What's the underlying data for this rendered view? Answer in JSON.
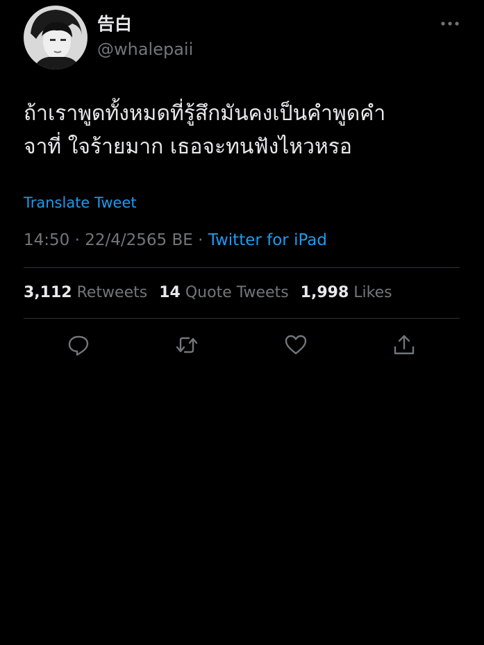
{
  "user": {
    "display_name": "告白",
    "handle": "@whalepaii",
    "avatar_icon": "profile-photo"
  },
  "tweet": {
    "text_line1": "ถ้าเราพูดทั้งหมดที่รู้สึกมันคงเป็นคำพูดคำ",
    "text_line2": "จาที่ ใจร้ายมาก เธอจะทนฟังไหวหรอ",
    "translate_label": "Translate Tweet",
    "time": "14:50",
    "date": "22/4/2565 BE",
    "separator": "·",
    "source": "Twitter for iPad"
  },
  "stats": {
    "retweets_count": "3,112",
    "retweets_label": "Retweets",
    "quotes_count": "14",
    "quotes_label": "Quote Tweets",
    "likes_count": "1,998",
    "likes_label": "Likes"
  },
  "actions": {
    "reply_icon": "reply-icon",
    "retweet_icon": "retweet-icon",
    "like_icon": "heart-icon",
    "share_icon": "share-icon"
  },
  "colors": {
    "background": "#000000",
    "text": "#e7e9ea",
    "secondary": "#71767b",
    "accent": "#1d9bf0",
    "divider": "#2f3336"
  }
}
